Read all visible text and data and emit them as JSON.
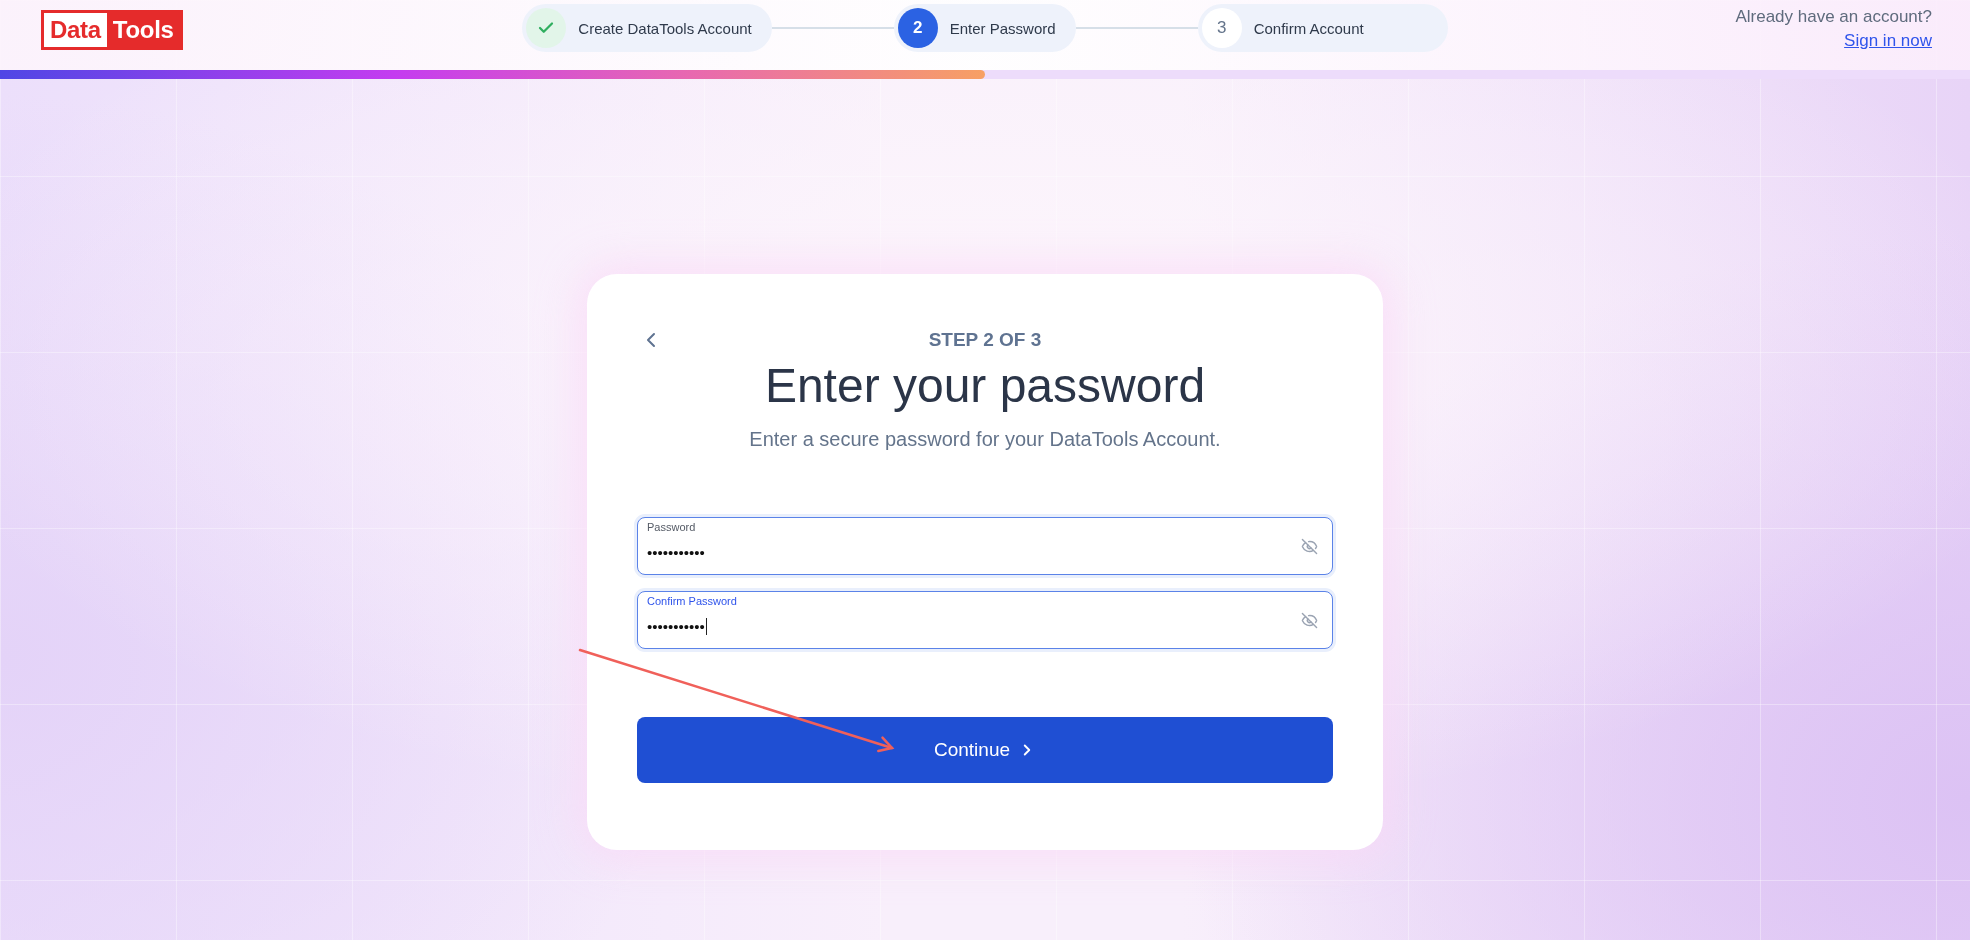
{
  "logo": {
    "words": [
      {
        "text": "Data",
        "inverted": false
      },
      {
        "text": "Tools",
        "inverted": true
      }
    ]
  },
  "stepper": {
    "steps": [
      {
        "label": "Create DataTools Account",
        "completed": true,
        "selected": false
      },
      {
        "number": "2",
        "label": "Enter Password",
        "completed": false,
        "selected": true
      },
      {
        "number": "3",
        "label": "Confirm Account",
        "completed": false,
        "selected": false
      }
    ]
  },
  "account_prompt": {
    "text": "Already have an account?",
    "link": "Sign in now"
  },
  "progress": {
    "level": 0.5
  },
  "card": {
    "step_indicator": "STEP 2 OF 3",
    "title": "Enter your password",
    "subtitle": "Enter a secure password for your DataTools Account.",
    "fields": [
      {
        "label": "Password",
        "value": "•••••••••••",
        "focused": false
      },
      {
        "label": "Confirm Password",
        "value": "•••••••••••",
        "focused": true
      }
    ],
    "button": "Continue"
  }
}
